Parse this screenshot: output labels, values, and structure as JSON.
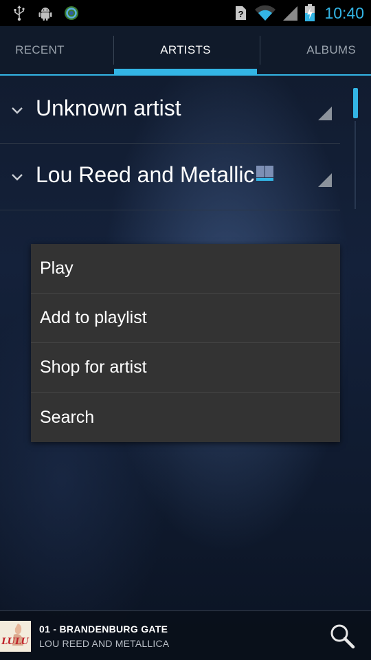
{
  "status_bar": {
    "time": "10:40",
    "left_icons": [
      "usb-icon",
      "android-debug-icon",
      "sync-icon"
    ],
    "right_icons": [
      "no-sim-icon",
      "wifi-icon",
      "signal-icon",
      "battery-charging-icon"
    ]
  },
  "tabs": [
    {
      "label": "RECENT",
      "selected": false
    },
    {
      "label": "ARTISTS",
      "selected": true
    },
    {
      "label": "ALBUMS",
      "selected": false
    }
  ],
  "artists": [
    {
      "name": "Unknown artist"
    },
    {
      "name": "Lou Reed and Metallic"
    }
  ],
  "context_menu": {
    "items": [
      "Play",
      "Add to playlist",
      "Shop for artist",
      "Search"
    ]
  },
  "now_playing": {
    "title": "01 - BRANDENBURG GATE",
    "artist": "LOU REED AND METALLICA",
    "album_art_text": "LULU"
  },
  "colors": {
    "accent": "#33b5e5",
    "menu_bg": "#333333",
    "status_bg": "#000000"
  }
}
